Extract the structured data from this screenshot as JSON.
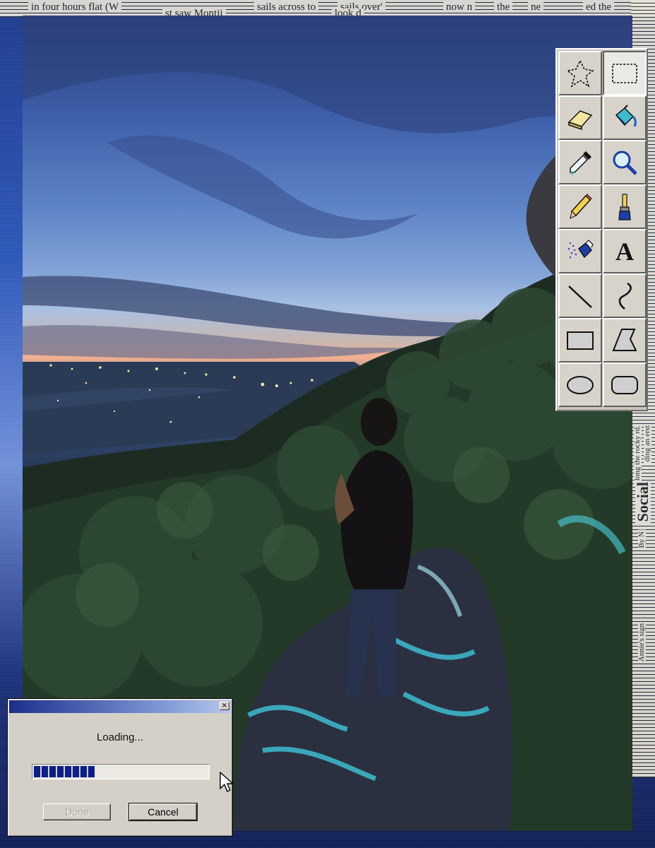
{
  "newspaper": {
    "top_snippets": [
      "in four hours flat (W",
      "sails across to",
      "st saw Montii",
      "sails over'",
      "look d",
      "now n",
      "the",
      "ne",
      "ed the"
    ],
    "right_snippets": [
      "along the rocky rd.",
      "ding an erst",
      "Social",
      "By N",
      "Annie's sign"
    ]
  },
  "toolbox": {
    "tools": [
      {
        "name": "free-select-tool",
        "icon": "free-select-icon",
        "selected": false
      },
      {
        "name": "rect-select-tool",
        "icon": "rect-select-icon",
        "selected": true
      },
      {
        "name": "eraser-tool",
        "icon": "eraser-icon",
        "selected": false
      },
      {
        "name": "fill-tool",
        "icon": "paint-bucket-icon",
        "selected": false
      },
      {
        "name": "color-picker-tool",
        "icon": "eyedropper-icon",
        "selected": false
      },
      {
        "name": "magnifier-tool",
        "icon": "magnifier-icon",
        "selected": false
      },
      {
        "name": "pencil-tool",
        "icon": "pencil-icon",
        "selected": false
      },
      {
        "name": "brush-tool",
        "icon": "brush-icon",
        "selected": false
      },
      {
        "name": "airbrush-tool",
        "icon": "airbrush-icon",
        "selected": false
      },
      {
        "name": "text-tool",
        "icon": "text-icon",
        "selected": false,
        "glyph": "A"
      },
      {
        "name": "line-tool",
        "icon": "line-icon",
        "selected": false
      },
      {
        "name": "curve-tool",
        "icon": "curve-icon",
        "selected": false
      },
      {
        "name": "rectangle-tool",
        "icon": "rectangle-icon",
        "selected": false
      },
      {
        "name": "polygon-tool",
        "icon": "polygon-icon",
        "selected": false
      },
      {
        "name": "ellipse-tool",
        "icon": "ellipse-icon",
        "selected": false
      },
      {
        "name": "rounded-rect-tool",
        "icon": "rounded-rect-icon",
        "selected": false
      }
    ]
  },
  "dialog": {
    "title": "",
    "close_glyph": "×",
    "message": "Loading...",
    "progress_fraction": 0.35,
    "done_label": "Done",
    "cancel_label": "Cancel"
  },
  "colors": {
    "titlebar_start": "#1c2f8c",
    "progress_fill": "#0c1f8c",
    "window_face": "#d4d0c8"
  }
}
